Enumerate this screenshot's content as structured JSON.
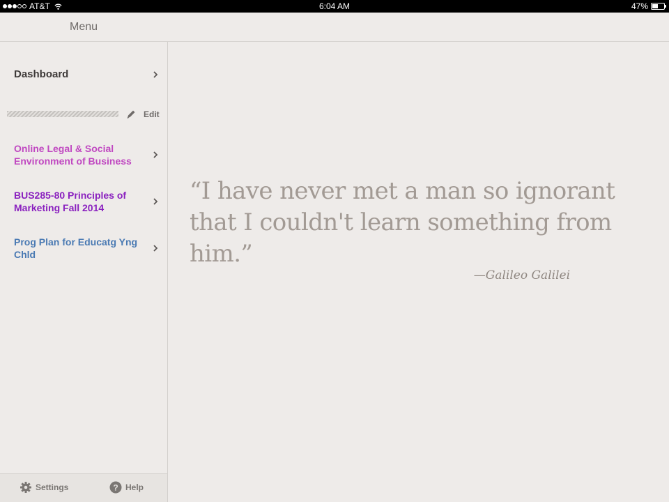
{
  "status_bar": {
    "carrier": "AT&T",
    "time": "6:04 AM",
    "battery_percent": "47%",
    "battery_level": 0.47,
    "signal_bars": 3
  },
  "header": {
    "menu_title": "Menu"
  },
  "sidebar": {
    "dashboard_label": "Dashboard",
    "edit_label": "Edit",
    "courses": [
      {
        "label": "Online Legal & Social Environment of Business",
        "color": "#c048c1"
      },
      {
        "label": "BUS285-80 Principles of Marketing Fall 2014",
        "color": "#8a20bf"
      },
      {
        "label": "Prog Plan for Educatg Yng Chld",
        "color": "#4a7ab3"
      }
    ],
    "footer": {
      "settings_label": "Settings",
      "help_label": "Help"
    }
  },
  "main": {
    "quote": "“I have never met a man so ignorant that I couldn't learn something from him.”",
    "author": "—Galileo Galilei"
  }
}
